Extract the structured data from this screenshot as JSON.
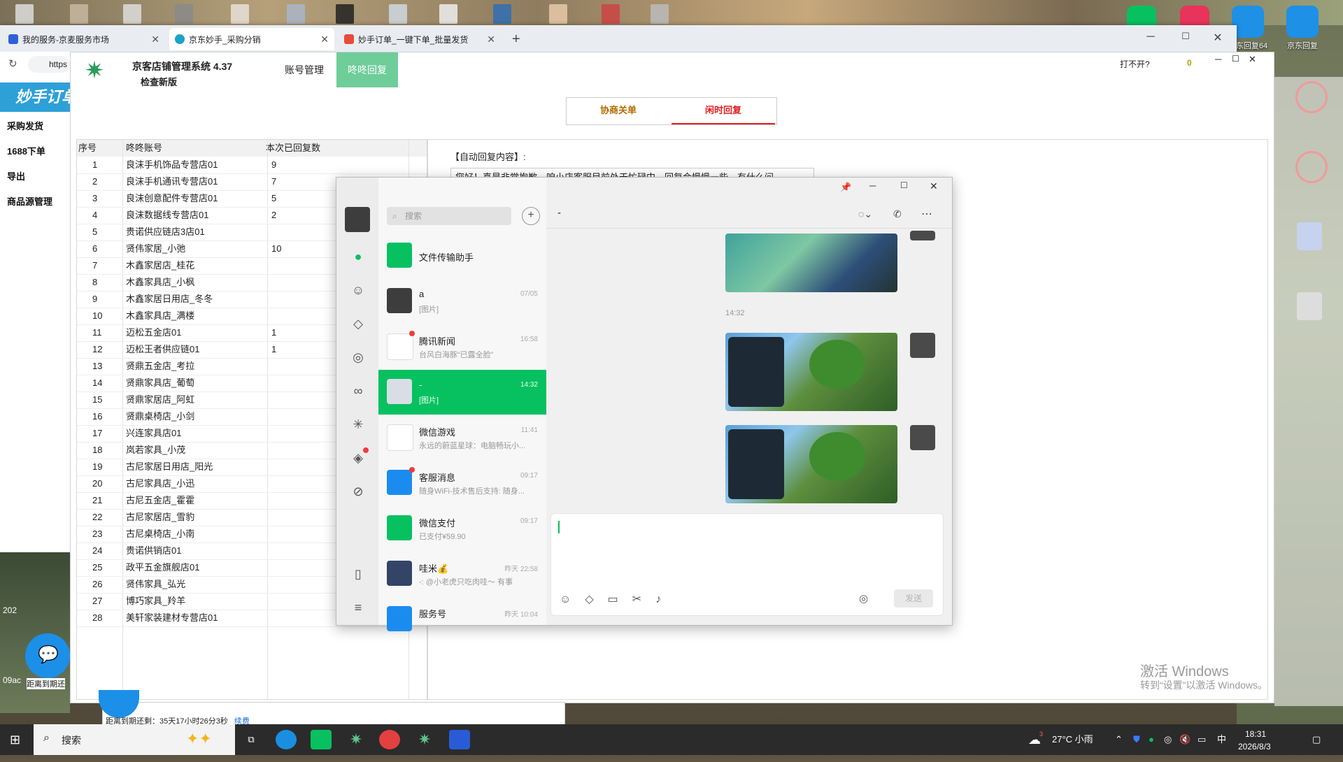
{
  "browser": {
    "tabs": [
      {
        "title": "我的服务-京麦服务市场"
      },
      {
        "title": "京东妙手_采购分销"
      },
      {
        "title": "妙手订单_一键下单_批量发货"
      }
    ],
    "address_text": "https",
    "new_tab_label": "+"
  },
  "sidebar": {
    "logo_text": "妙手订单",
    "items": [
      "采购发货",
      "1688下单",
      "导出",
      "商品源管理"
    ]
  },
  "app": {
    "title": "京客店铺管理系统 4.37",
    "subtitle": "检查新版",
    "nav": [
      "账号管理",
      "咚咚回复"
    ],
    "right_text": "打不开?",
    "counter": "0",
    "segments": [
      "协商关单",
      "闲时回复"
    ],
    "auto_reply_label": "【自动回复内容】:",
    "auto_reply_text": "您好！真是非常抱歉，咱小店客服目前处于忙碌中，回复会慢慢一些，有什么问"
  },
  "table": {
    "headers": [
      "序号",
      "咚咚账号",
      "本次已回复数"
    ],
    "rows": [
      [
        "1",
        "良沫手机饰品专营店01",
        "9"
      ],
      [
        "2",
        "良沫手机通讯专营店01",
        "7"
      ],
      [
        "3",
        "良沫创意配件专营店01",
        "5"
      ],
      [
        "4",
        "良沫数据线专营店01",
        "2"
      ],
      [
        "5",
        "贵诺供应链店3店01",
        ""
      ],
      [
        "6",
        "贤伟家居_小弛",
        "10"
      ],
      [
        "7",
        "木鑫家居店_桂花",
        ""
      ],
      [
        "8",
        "木鑫家具店_小枫",
        ""
      ],
      [
        "9",
        "木鑫家居日用店_冬冬",
        ""
      ],
      [
        "10",
        "木鑫家具店_满楼",
        ""
      ],
      [
        "11",
        "迈松五金店01",
        "1"
      ],
      [
        "12",
        "迈松王者供应链01",
        "1"
      ],
      [
        "13",
        "贤鼎五金店_考拉",
        ""
      ],
      [
        "14",
        "贤鼎家具店_葡萄",
        ""
      ],
      [
        "15",
        "贤鼎家居店_阿虹",
        ""
      ],
      [
        "16",
        "贤鼎桌椅店_小剑",
        ""
      ],
      [
        "17",
        "兴连家具店01",
        ""
      ],
      [
        "18",
        "岚若家具_小茂",
        ""
      ],
      [
        "19",
        "古尼家居日用店_阳光",
        ""
      ],
      [
        "20",
        "古尼家具店_小迅",
        ""
      ],
      [
        "21",
        "古尼五金店_霍霍",
        ""
      ],
      [
        "22",
        "古尼家居店_雪豹",
        ""
      ],
      [
        "23",
        "古尼桌椅店_小南",
        ""
      ],
      [
        "24",
        "贵诺供销店01",
        ""
      ],
      [
        "25",
        "政平五金旗舰店01",
        ""
      ],
      [
        "26",
        "贤伟家具_弘光",
        ""
      ],
      [
        "27",
        "博巧家具_羚羊",
        ""
      ],
      [
        "28",
        "美轩家装建材专营店01",
        ""
      ]
    ]
  },
  "wechat": {
    "search_placeholder": "搜索",
    "chat_title": "-",
    "conversations": [
      {
        "name": "文件传输助手",
        "preview": "",
        "time": ""
      },
      {
        "name": "a",
        "preview": "[图片]",
        "time": "07/05"
      },
      {
        "name": "腾讯新闻",
        "preview": "台风白海豚“已露全脸”",
        "time": "16:58"
      },
      {
        "name": "-",
        "preview": "[图片]",
        "time": "14:32"
      },
      {
        "name": "微信游戏",
        "preview": "永远的蔚蓝星球：电脑畅玩小...",
        "time": "11:41"
      },
      {
        "name": "客服消息",
        "preview": "随身WiFi-技术售后支持: 随身...",
        "time": "09:17"
      },
      {
        "name": "微信支付",
        "preview": "已支付¥59.90",
        "time": "09:17"
      },
      {
        "name": "哇米💰",
        "preview": "-: @小老虎只吃肉哇～ 有事",
        "time": "昨天 22:58"
      },
      {
        "name": "服务号",
        "preview": "",
        "time": "昨天 10:04"
      }
    ],
    "timestamp": "14:32",
    "send_label": "发送"
  },
  "desktop": {
    "right_icons": [
      "京东回复64",
      "京东回复"
    ],
    "left_stub": "距离到期还",
    "bottom_stub": "距离到期还剩：35天17小时26分3秒",
    "bottom_link": "续费",
    "left_year": "202",
    "left_date": "09ac"
  },
  "activation": {
    "title": "激活 Windows",
    "subtitle": "转到“设置”以激活 Windows。"
  },
  "taskbar": {
    "search_label": "搜索",
    "weather": "27°C 小雨",
    "ime": "中",
    "time": "18:31",
    "date": "2026/8/3",
    "weather_badge": "3"
  }
}
